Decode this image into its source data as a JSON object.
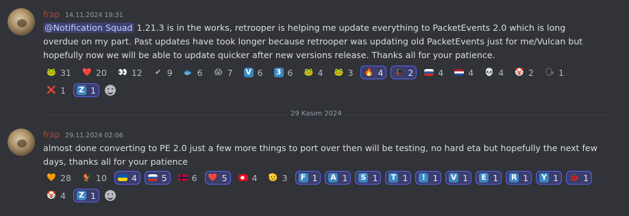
{
  "messages": [
    {
      "username": "frap",
      "timestamp": "14.11.2024 19:31",
      "mention": "@Notification Squad",
      "text": " 1.21.3 is in the works, retrooper is helping me update everything to PacketEvents 2.0 which is long overdue on my part. Past updates have took longer because retrooper was updating old PacketEvents just for me/Vulcan but hopefully now we will be able to update quicker after new versions release. Thanks all for your patience.",
      "reactions": [
        {
          "emoji": "🐸",
          "count": "31"
        },
        {
          "emoji": "❤️",
          "count": "20"
        },
        {
          "emoji": "👀",
          "count": "12"
        },
        {
          "emoji": "✔",
          "count": "9"
        },
        {
          "emoji": "🐟",
          "count": "6"
        },
        {
          "emoji": "😱",
          "count": "7"
        },
        {
          "emoji": "V",
          "count": "6"
        },
        {
          "emoji": "3",
          "count": "6"
        },
        {
          "emoji": "🐸",
          "count": "4"
        },
        {
          "emoji": "🐸",
          "count": "3"
        },
        {
          "emoji": "🔥",
          "count": "4",
          "me": true
        },
        {
          "emoji": "🎩",
          "count": "2",
          "me": true
        },
        {
          "emoji": "RU",
          "count": "4"
        },
        {
          "emoji": "NL",
          "count": "4"
        },
        {
          "emoji": "💀",
          "count": "4"
        },
        {
          "emoji": "🤡",
          "count": "2"
        },
        {
          "emoji": "🗣",
          "count": "1"
        },
        {
          "emoji": "❌",
          "count": "1"
        },
        {
          "emoji": "Z",
          "count": "1",
          "me": true
        }
      ]
    },
    {
      "username": "frap",
      "timestamp": "29.11.2024 02:06",
      "text": "almost done converting to PE 2.0 just a few more things to port over then will be testing, no hard eta but hopefully the next few days, thanks all for your patience",
      "reactions": [
        {
          "emoji": "🧡",
          "count": "28"
        },
        {
          "emoji": "🐓",
          "count": "10"
        },
        {
          "emoji": "UA",
          "count": "4",
          "me": true
        },
        {
          "emoji": "RU",
          "count": "5",
          "me": true
        },
        {
          "emoji": "NO",
          "count": "6"
        },
        {
          "emoji": "❤️",
          "count": "5",
          "me": true
        },
        {
          "emoji": "TR",
          "count": "4"
        },
        {
          "emoji": "🫡",
          "count": "3"
        },
        {
          "emoji": "F",
          "count": "1",
          "me": true
        },
        {
          "emoji": "A",
          "count": "1",
          "me": true
        },
        {
          "emoji": "S",
          "count": "1",
          "me": true
        },
        {
          "emoji": "T",
          "count": "1",
          "me": true
        },
        {
          "emoji": "!",
          "count": "1",
          "me": true
        },
        {
          "emoji": "V",
          "count": "1",
          "me": true
        },
        {
          "emoji": "E",
          "count": "1",
          "me": true
        },
        {
          "emoji": "R",
          "count": "1",
          "me": true
        },
        {
          "emoji": "Y",
          "count": "1",
          "me": true
        },
        {
          "emoji": "🐞",
          "count": "1",
          "me": true
        },
        {
          "emoji": "🤡",
          "count": "4"
        },
        {
          "emoji": "Z",
          "count": "1",
          "me": true
        }
      ]
    }
  ],
  "divider": {
    "label": "29 Kasım 2024"
  }
}
